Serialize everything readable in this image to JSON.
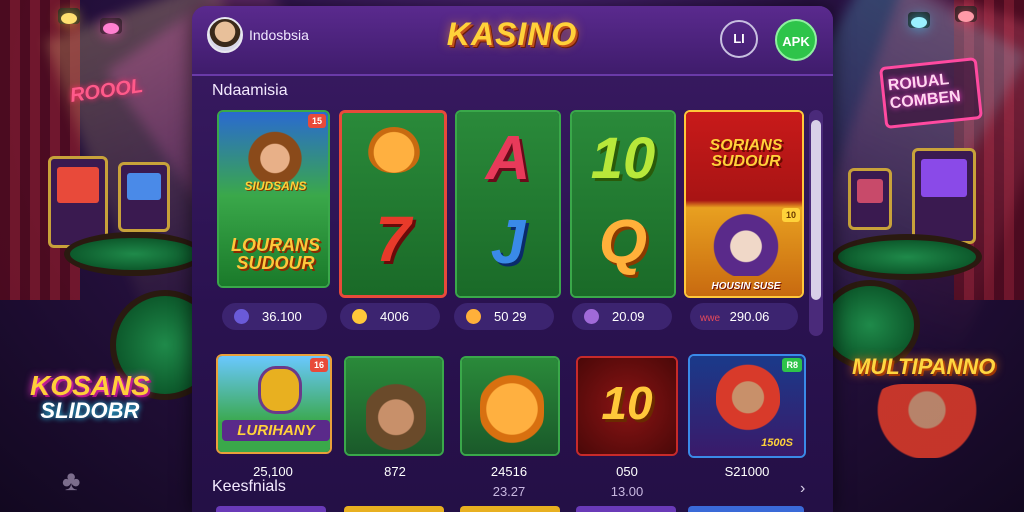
{
  "header": {
    "user_name": "Indosbsia",
    "logo_text": "KASINO",
    "li_button": "LI",
    "apk_button": "APK"
  },
  "sections": [
    {
      "title": "Ndaamisia"
    },
    {
      "title": "Keesfnials"
    }
  ],
  "row1": [
    {
      "top_text": "SIUDSANS",
      "bottom_text": "LOURANS SUDOUR",
      "badge": "15",
      "value": "36.100",
      "coin_color": "#6a5ad8"
    },
    {
      "top_text": "",
      "bottom_text": "7",
      "value": "4006",
      "coin_color": "#ffc83a"
    },
    {
      "top_text": "A",
      "bottom_text": "J",
      "value": "50 29",
      "coin_color": "#ffb03a"
    },
    {
      "top_text": "10",
      "bottom_text": "Q",
      "value": "20.09",
      "coin_color": "#a06ad8"
    },
    {
      "top_text": "SORIANS SUDOUR",
      "bottom_text": "HOUSIN SUSE",
      "badge": "10",
      "value": "290.06",
      "coin_color": "#e84a5a",
      "prefix": "wwe"
    }
  ],
  "row2": [
    {
      "label": "LURIHANY",
      "badge": "16",
      "value": "25,100"
    },
    {
      "label": "",
      "value": "872"
    },
    {
      "label": "",
      "value": "24516",
      "sub_value": "23.27"
    },
    {
      "label": "10",
      "value": "050",
      "sub_value": "13.00"
    },
    {
      "label": "1500S",
      "badge": "R8",
      "value": "S21000"
    }
  ],
  "background": {
    "left_sign_main": "KOSANS",
    "left_sign_sub": "SLIDOBR",
    "right_sign": "MULTIPANNO",
    "roulette_sign": "ROIUAL COMBEN",
    "doodle_sign": "ROOOL"
  },
  "colors": {
    "panel_bg": "#2a1250",
    "accent_gold": "#ffd23a",
    "apk_green": "#2ec44a",
    "pill_bg": "#3c2470"
  },
  "icons": {
    "scroll_down": "chevron-down-icon",
    "avatar": "avatar"
  }
}
